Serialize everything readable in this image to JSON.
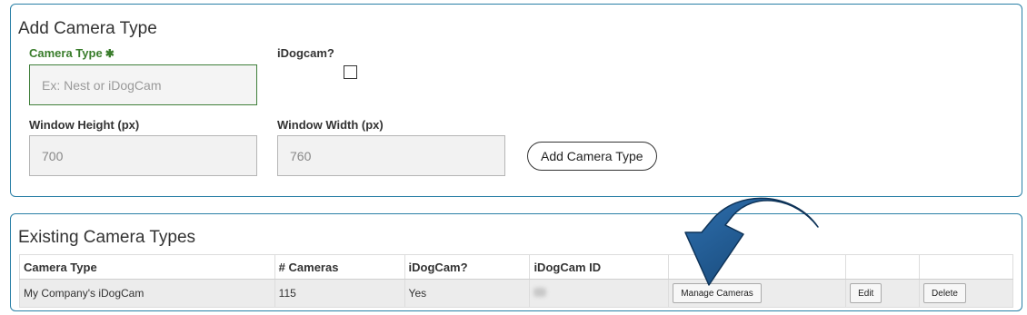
{
  "add_panel": {
    "title": "Add Camera Type",
    "camera_type": {
      "label": "Camera Type",
      "required_mark": "✱",
      "placeholder": "Ex: Nest or iDogCam",
      "value": ""
    },
    "idogcam": {
      "label": "iDogcam?",
      "checked": false
    },
    "window_height": {
      "label": "Window Height (px)",
      "value": "700"
    },
    "window_width": {
      "label": "Window Width (px)",
      "value": "760"
    },
    "submit_label": "Add Camera Type"
  },
  "existing_panel": {
    "title": "Existing Camera Types",
    "columns": [
      "Camera Type",
      "# Cameras",
      "iDogCam?",
      "iDogCam ID",
      "",
      "",
      ""
    ],
    "rows": [
      {
        "camera_type": "My Company's iDogCam",
        "cameras": "115",
        "idogcam": "Yes",
        "manage_label": "Manage Cameras",
        "edit_label": "Edit",
        "delete_label": "Delete"
      }
    ]
  },
  "colors": {
    "panel_border": "#2a7fa6",
    "required_label": "#3a7d2c",
    "arrow": "#1d5a8e"
  },
  "icons": {
    "overlay_arrow": "curved-arrow-icon"
  }
}
